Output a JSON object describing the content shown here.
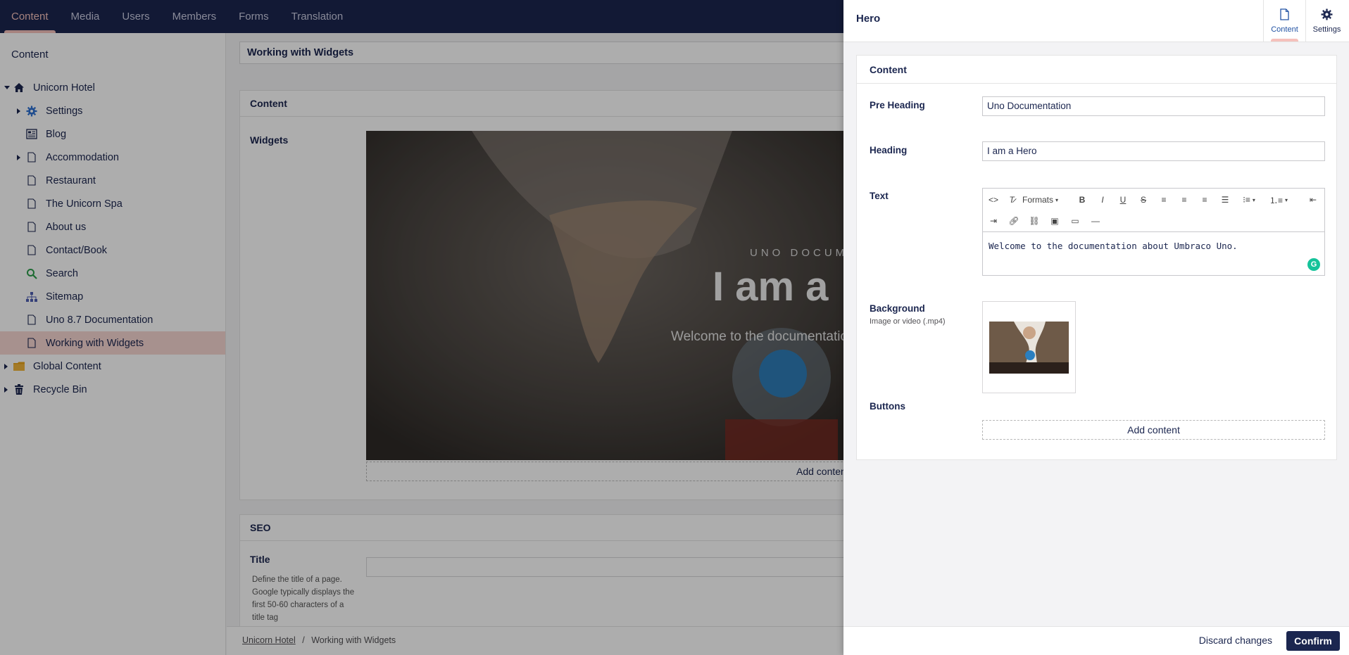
{
  "topnav": {
    "items": [
      "Content",
      "Media",
      "Users",
      "Members",
      "Forms",
      "Translation"
    ],
    "active_index": 0
  },
  "sidebar": {
    "title": "Content",
    "tree": [
      {
        "label": "Unicorn Hotel",
        "icon": "home-icon"
      },
      {
        "label": "Settings",
        "icon": "gear-icon"
      },
      {
        "label": "Blog",
        "icon": "blog-icon"
      },
      {
        "label": "Accommodation",
        "icon": "document-icon"
      },
      {
        "label": "Restaurant",
        "icon": "document-icon"
      },
      {
        "label": "The Unicorn Spa",
        "icon": "document-icon"
      },
      {
        "label": "About us",
        "icon": "document-icon"
      },
      {
        "label": "Contact/Book",
        "icon": "document-icon"
      },
      {
        "label": "Search",
        "icon": "search-icon"
      },
      {
        "label": "Sitemap",
        "icon": "sitemap-icon"
      },
      {
        "label": "Uno 8.7 Documentation",
        "icon": "document-icon"
      },
      {
        "label": "Working with Widgets",
        "icon": "document-icon"
      },
      {
        "label": "Global Content",
        "icon": "folder-icon"
      },
      {
        "label": "Recycle Bin",
        "icon": "trash-icon"
      }
    ]
  },
  "editor": {
    "page_name": "Working with Widgets",
    "content_group": "Content",
    "widgets_label": "Widgets",
    "hero_preview": {
      "pre_heading": "UNO DOCUMEN",
      "heading": "I am a",
      "text": "Welcome to the documentation"
    },
    "add_content": "Add content",
    "seo_group": "SEO",
    "seo_title_label": "Title",
    "seo_title_desc": "Define the title of a page. Google typically displays the first 50-60 characters of a title tag"
  },
  "breadcrumb": {
    "root": "Unicorn Hotel",
    "separator": "/",
    "current": "Working with Widgets"
  },
  "drawer": {
    "title": "Hero",
    "tabs": [
      {
        "label": "Content",
        "icon": "document-icon"
      },
      {
        "label": "Settings",
        "icon": "gear-icon"
      }
    ],
    "group": "Content",
    "pre_heading": {
      "label": "Pre Heading",
      "value": "Uno Documentation"
    },
    "heading": {
      "label": "Heading",
      "value": "I am a Hero"
    },
    "text": {
      "label": "Text",
      "formats_label": "Formats",
      "value": "Welcome to the documentation about Umbraco Uno."
    },
    "background": {
      "label": "Background",
      "sub": "Image or video (.mp4)"
    },
    "buttons": {
      "label": "Buttons",
      "add": "Add content"
    },
    "discard": "Discard changes",
    "confirm": "Confirm"
  },
  "colors": {
    "nav_bg": "#1b264f",
    "accent": "#f5c1bc",
    "selected_bg": "#f7d6d2",
    "confirm_bg": "#1b264f"
  }
}
